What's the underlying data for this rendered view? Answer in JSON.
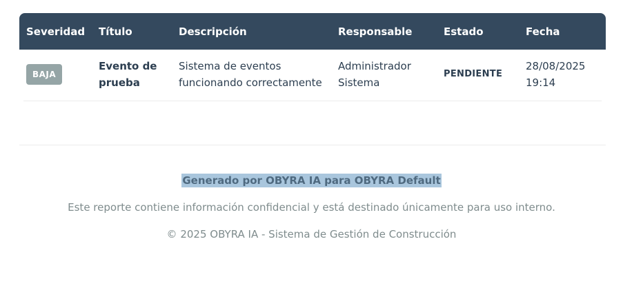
{
  "table": {
    "headers": [
      "Severidad",
      "Título",
      "Descripción",
      "Responsable",
      "Estado",
      "Fecha"
    ],
    "rows": [
      {
        "severity": "BAJA",
        "title_line1": "Evento de",
        "title_line2": "prueba",
        "description_line1": "Sistema de eventos",
        "description_line2": "funcionando correctamente",
        "owner_line1": "Administrador",
        "owner_line2": "Sistema",
        "status": "PENDIENTE",
        "date_line1": "28/08/2025",
        "date_line2": "19:14"
      }
    ]
  },
  "footer": {
    "generated": "Generado por OBYRA IA para OBYRA Default",
    "confidential": "Este reporte contiene información confidencial y está destinado únicamente para uso interno.",
    "copyright": "© 2025 OBYRA IA - Sistema de Gestión de Construcción"
  },
  "colors": {
    "header_bg": "#34495e",
    "badge_low": "#95a5a6",
    "highlight": "#a9c6dd"
  }
}
